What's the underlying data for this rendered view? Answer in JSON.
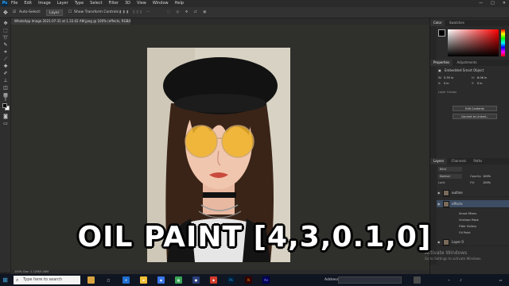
{
  "app": {
    "logo": "Ps"
  },
  "menu": [
    "File",
    "Edit",
    "Image",
    "Layer",
    "Type",
    "Select",
    "Filter",
    "3D",
    "View",
    "Window",
    "Help"
  ],
  "window_controls": [
    "—",
    "□",
    "✕"
  ],
  "options_bar": {
    "auto_select_label": "Auto-Select:",
    "auto_select_value": "Layer",
    "show_transform_label": "Show Transform Controls"
  },
  "document_tab": {
    "title": "WhatsApp Image 2021-07-31 at 1.33.02 AM.jpeg @ 100% (effects, RGB/8#) *"
  },
  "status_bar": {
    "text": "100%    Doc: 1.12M/5.48M"
  },
  "panels": {
    "color_tabs": [
      "Color",
      "Swatches"
    ],
    "properties_tabs": [
      "Properties",
      "Adjustments"
    ],
    "properties_title": "Embedded Smart Object",
    "properties_fields": {
      "w_label": "W:",
      "w_value": "5.35 in",
      "h_label": "H:",
      "h_value": "8.06 in",
      "x_label": "X:",
      "x_value": "0 in",
      "y_label": "Y:",
      "y_value": "0 in"
    },
    "properties_layer_comps": "Layer Comps",
    "properties_buttons": [
      "Edit Contents",
      "Convert to Linked..."
    ],
    "layers_tabs": [
      "Layers",
      "Channels",
      "Paths"
    ],
    "layers_kind": "Kind",
    "blend_mode": "Normal",
    "opacity_label": "Opacity:",
    "opacity_value": "100%",
    "lock_label": "Lock:",
    "fill_label": "Fill:",
    "fill_value": "100%",
    "layers": [
      {
        "name": "outline"
      },
      {
        "name": "effects"
      }
    ],
    "smart_filters": [
      "Smart Filters",
      "Unsharp Mask",
      "Filter Gallery",
      "Oil Paint"
    ],
    "bottom_layer": {
      "name": "Layer 0"
    }
  },
  "watermark": {
    "line1": "Activate Windows",
    "line2": "Go to Settings to activate Windows."
  },
  "taskbar": {
    "search_placeholder": "Type here to search",
    "address_label": "Address",
    "apps": [
      "Ps",
      "Ai",
      "Ae"
    ]
  },
  "caption": "OIL PAINT [4,3,0.1,0]"
}
